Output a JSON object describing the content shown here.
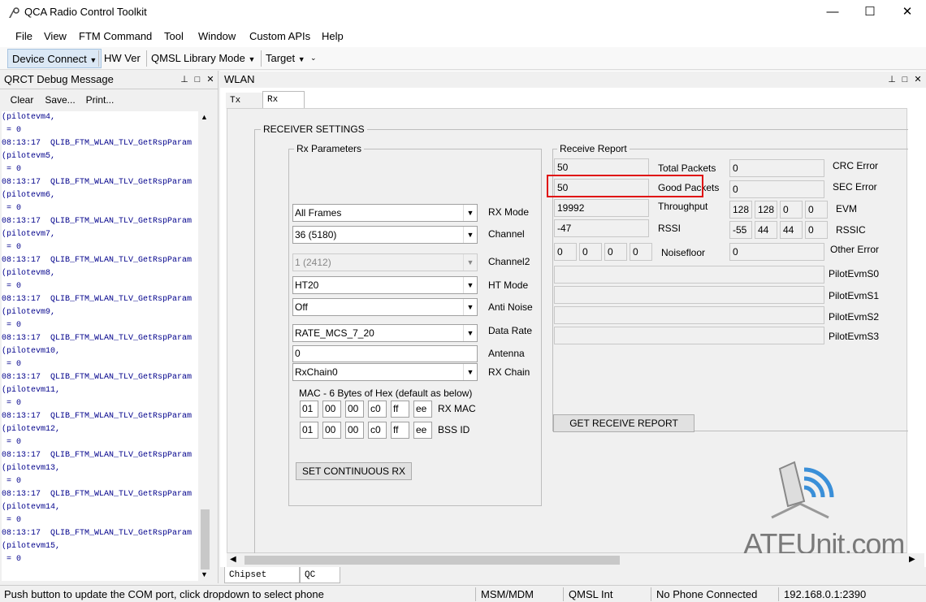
{
  "window": {
    "title": "QCA Radio Control Toolkit",
    "minimize": "—",
    "maximize": "☐",
    "close": "✕"
  },
  "menu": [
    "File",
    "View",
    "FTM Command",
    "Tool",
    "Window",
    "Custom APIs",
    "Help"
  ],
  "toolbar": {
    "device_connect": "Device Connect",
    "hw_ver": "HW Ver",
    "qmsl_mode": "QMSL Library Mode",
    "target": "Target"
  },
  "debug_panel": {
    "title": "QRCT Debug Message",
    "clear": "Clear",
    "save": "Save...",
    "print": "Print...",
    "log": [
      {
        "time": "",
        "text": "(pilotevm4,",
        "value": " = 0",
        "first": true
      },
      {
        "time": "08:13:17",
        "text": "QLIB_FTM_WLAN_TLV_GetRspParam",
        "param": "(pilotevm5,",
        "value": " = 0"
      },
      {
        "time": "08:13:17",
        "text": "QLIB_FTM_WLAN_TLV_GetRspParam",
        "param": "(pilotevm6,",
        "value": " = 0"
      },
      {
        "time": "08:13:17",
        "text": "QLIB_FTM_WLAN_TLV_GetRspParam",
        "param": "(pilotevm7,",
        "value": " = 0"
      },
      {
        "time": "08:13:17",
        "text": "QLIB_FTM_WLAN_TLV_GetRspParam",
        "param": "(pilotevm8,",
        "value": " = 0"
      },
      {
        "time": "08:13:17",
        "text": "QLIB_FTM_WLAN_TLV_GetRspParam",
        "param": "(pilotevm9,",
        "value": " = 0"
      },
      {
        "time": "08:13:17",
        "text": "QLIB_FTM_WLAN_TLV_GetRspParam",
        "param": "(pilotevm10,",
        "value": " = 0"
      },
      {
        "time": "08:13:17",
        "text": "QLIB_FTM_WLAN_TLV_GetRspParam",
        "param": "(pilotevm11,",
        "value": " = 0"
      },
      {
        "time": "08:13:17",
        "text": "QLIB_FTM_WLAN_TLV_GetRspParam",
        "param": "(pilotevm12,",
        "value": " = 0"
      },
      {
        "time": "08:13:17",
        "text": "QLIB_FTM_WLAN_TLV_GetRspParam",
        "param": "(pilotevm13,",
        "value": " = 0"
      },
      {
        "time": "08:13:17",
        "text": "QLIB_FTM_WLAN_TLV_GetRspParam",
        "param": "(pilotevm14,",
        "value": " = 0"
      },
      {
        "time": "08:13:17",
        "text": "QLIB_FTM_WLAN_TLV_GetRspParam",
        "param": "(pilotevm15,",
        "value": " = 0"
      }
    ]
  },
  "wlan_panel": {
    "title": "WLAN",
    "tabs": [
      "Tx",
      "Rx"
    ],
    "active_tab": "Rx",
    "bottom_tabs": [
      "Chipset Select",
      "QC"
    ],
    "receiver_settings": "RECEIVER SETTINGS",
    "rx_params": {
      "title": "Rx Parameters",
      "rx_mode": {
        "label": "RX Mode",
        "value": "All Frames"
      },
      "channel": {
        "label": "Channel",
        "value": "36 (5180)"
      },
      "channel2": {
        "label": "Channel2",
        "value": "1 (2412)"
      },
      "ht_mode": {
        "label": "HT Mode",
        "value": "HT20"
      },
      "anti_noise": {
        "label": "Anti Noise",
        "value": "Off"
      },
      "data_rate": {
        "label": "Data Rate",
        "value": "RATE_MCS_7_20"
      },
      "antenna": {
        "label": "Antenna",
        "value": "0"
      },
      "rx_chain": {
        "label": "RX Chain",
        "value": "RxChain0"
      },
      "mac_note": "MAC - 6 Bytes of Hex (default as below)",
      "rx_mac": {
        "label": "RX MAC",
        "bytes": [
          "01",
          "00",
          "00",
          "c0",
          "ff",
          "ee"
        ]
      },
      "bss_id": {
        "label": "BSS ID",
        "bytes": [
          "01",
          "00",
          "00",
          "c0",
          "ff",
          "ee"
        ]
      },
      "set_button": "SET CONTINUOUS RX"
    },
    "receive_report": {
      "title": "Receive Report",
      "total_packets": {
        "label": "Total Packets",
        "value": "50"
      },
      "good_packets": {
        "label": "Good Packets",
        "value": "50"
      },
      "throughput": {
        "label": "Throughput",
        "value": "19992"
      },
      "rssi": {
        "label": "RSSI",
        "value": "-47"
      },
      "noisefloor": {
        "label": "Noisefloor",
        "values": [
          "0",
          "0",
          "0",
          "0"
        ]
      },
      "crc_error": {
        "label": "CRC Error",
        "value": "0"
      },
      "sec_error": {
        "label": "SEC Error",
        "value": "0"
      },
      "evm": {
        "label": "EVM",
        "values": [
          "128",
          "128",
          "0",
          "0"
        ]
      },
      "rssic": {
        "label": "RSSIC",
        "values": [
          "-55",
          "44",
          "44",
          "0"
        ]
      },
      "other_error": {
        "label": "Other Error",
        "value": "0"
      },
      "pilot": [
        "PilotEvmS0",
        "PilotEvmS1",
        "PilotEvmS2",
        "PilotEvmS3"
      ],
      "get_button": "GET RECEIVE REPORT",
      "highlight_color": "#e01010"
    }
  },
  "watermark": "ATEUnit.com",
  "status": {
    "message": "Push button to update the COM port, click dropdown to select phone",
    "msm": "MSM/MDM",
    "qmsl": "QMSL Int",
    "phone": "No Phone Connected",
    "ip": "192.168.0.1:2390"
  }
}
